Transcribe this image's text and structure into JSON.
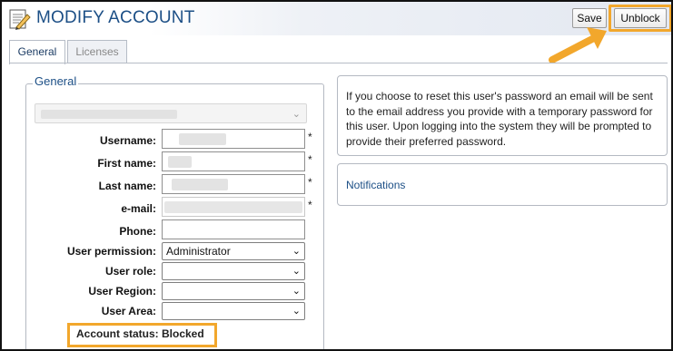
{
  "header": {
    "title": "MODIFY ACCOUNT",
    "save_label": "Save",
    "unblock_label": "Unblock",
    "highlight_color": "#f2a72c",
    "title_color": "#1c4f86"
  },
  "tabs": [
    {
      "label": "General",
      "active": true
    },
    {
      "label": "Licenses",
      "active": false
    }
  ],
  "general": {
    "legend": "General",
    "fields": {
      "username": {
        "label": "Username:",
        "value": "",
        "required": "*"
      },
      "first_name": {
        "label": "First name:",
        "value": "",
        "required": "*"
      },
      "last_name": {
        "label": "Last name:",
        "value": "",
        "required": "*"
      },
      "email": {
        "label": "e-mail:",
        "value": "",
        "required": "*"
      },
      "phone": {
        "label": "Phone:",
        "value": ""
      },
      "user_permission": {
        "label": "User permission:",
        "value": "Administrator"
      },
      "user_role": {
        "label": "User role:",
        "value": ""
      },
      "user_region": {
        "label": "User Region:",
        "value": ""
      },
      "user_area": {
        "label": "User Area:",
        "value": ""
      }
    },
    "account_status": {
      "label": "Account status:",
      "value": "Blocked"
    }
  },
  "info_panel": {
    "text": "If you choose to reset this user's password an email will be sent to the email address you provide with a temporary password for this user. Upon logging into the system they will be prompted to provide their preferred password."
  },
  "notifications": {
    "label": "Notifications"
  },
  "icons": {
    "app": "document-edit-icon",
    "arrow": "callout-arrow-icon",
    "dropdown": "chevron-down-icon"
  }
}
